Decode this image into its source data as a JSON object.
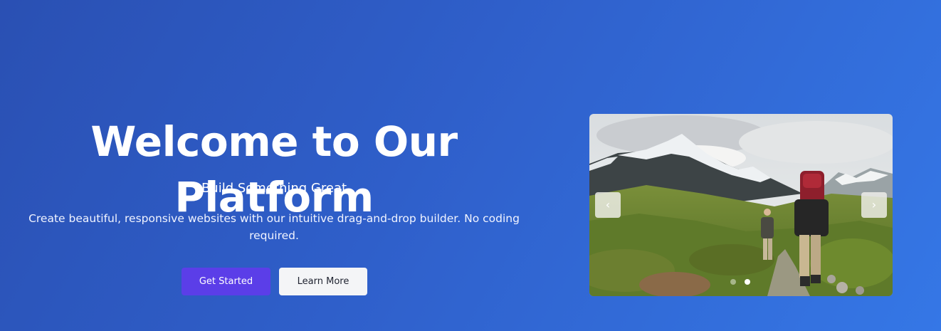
{
  "hero": {
    "title": "Welcome to Our Platform",
    "subtitle": "Build Something Great",
    "description": "Create beautiful, responsive websites with our intuitive drag-and-drop builder. No coding required.",
    "primary_button": "Get Started",
    "secondary_button": "Learn More"
  },
  "carousel": {
    "prev_icon": "‹",
    "next_icon": "›",
    "slide_count": 2,
    "active_slide": 2,
    "slide_image": "hikers-mountain-trail-photo"
  },
  "colors": {
    "primary_button": "#5b3ee8",
    "secondary_button": "#f4f5f7",
    "background_start": "#2a50b3",
    "background_end": "#3577e6"
  }
}
